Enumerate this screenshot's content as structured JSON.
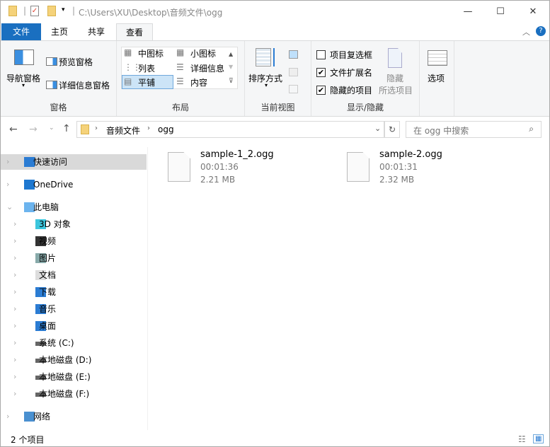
{
  "window": {
    "path": "C:\\Users\\XU\\Desktop\\音频文件\\ogg",
    "minimize": "—",
    "maximize": "☐",
    "close": "✕"
  },
  "tabs": [
    {
      "label": "文件"
    },
    {
      "label": "主页"
    },
    {
      "label": "共享"
    },
    {
      "label": "查看"
    }
  ],
  "ribbon": {
    "panes": {
      "nav_pane": "导航窗格",
      "preview": "预览窗格",
      "details": "详细信息窗格",
      "label": "窗格"
    },
    "layout": {
      "items": [
        "中图标",
        "小图标",
        "列表",
        "详细信息",
        "平铺",
        "内容"
      ],
      "selected": "平铺",
      "label": "布局"
    },
    "current_view": {
      "sort": "排序方式",
      "label": "当前视图"
    },
    "show_hide": {
      "item_checkboxes": "项目复选框",
      "extensions": "文件扩展名",
      "hidden_items": "隐藏的项目",
      "hide_selected_1": "隐藏",
      "hide_selected_2": "所选项目",
      "label": "显示/隐藏",
      "checked": {
        "item_checkboxes": false,
        "extensions": true,
        "hidden_items": true
      }
    },
    "options": "选项"
  },
  "address": {
    "crumbs": [
      "音频文件",
      "ogg"
    ],
    "search_placeholder": "在 ogg 中搜索"
  },
  "nav": [
    {
      "label": "快速访问",
      "level": 0,
      "icon": "star-icon",
      "selected": true
    },
    {
      "label": "OneDrive",
      "level": 0,
      "icon": "cloud-icon"
    },
    {
      "label": "此电脑",
      "level": 0,
      "icon": "computer-icon",
      "expanded": true
    },
    {
      "label": "3D 对象",
      "level": 1,
      "icon": "cube-icon"
    },
    {
      "label": "视频",
      "level": 1,
      "icon": "video-icon"
    },
    {
      "label": "图片",
      "level": 1,
      "icon": "picture-icon"
    },
    {
      "label": "文档",
      "level": 1,
      "icon": "document-icon"
    },
    {
      "label": "下载",
      "level": 1,
      "icon": "download-icon"
    },
    {
      "label": "音乐",
      "level": 1,
      "icon": "music-icon"
    },
    {
      "label": "桌面",
      "level": 1,
      "icon": "desktop-icon"
    },
    {
      "label": "系统 (C:)",
      "level": 1,
      "icon": "drive-icon"
    },
    {
      "label": "本地磁盘 (D:)",
      "level": 1,
      "icon": "drive-icon"
    },
    {
      "label": "本地磁盘 (E:)",
      "level": 1,
      "icon": "drive-icon"
    },
    {
      "label": "本地磁盘 (F:)",
      "level": 1,
      "icon": "drive-icon"
    },
    {
      "label": "网络",
      "level": 0,
      "icon": "network-icon"
    }
  ],
  "files": [
    {
      "name": "sample-1_2.ogg",
      "duration": "00:01:36",
      "size": "2.21 MB"
    },
    {
      "name": "sample-2.ogg",
      "duration": "00:01:31",
      "size": "2.32 MB"
    }
  ],
  "status": {
    "count": "2 个项目"
  }
}
